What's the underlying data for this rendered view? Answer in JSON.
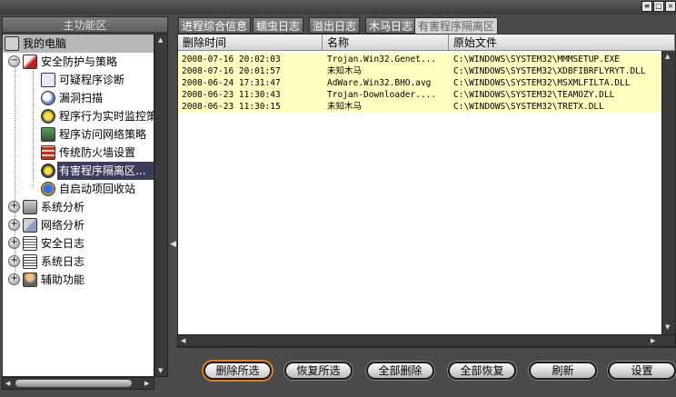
{
  "window": {
    "controls": [
      "≡",
      "□",
      "×"
    ]
  },
  "left_panel": {
    "title": "主功能区",
    "tree": [
      {
        "id": "my-computer",
        "label": "我的电脑"
      },
      {
        "id": "security-policy",
        "label": "安全防护与策略",
        "expander": "−"
      },
      {
        "id": "suspicious-diag",
        "label": "可疑程序诊断"
      },
      {
        "id": "vuln-scan",
        "label": "漏洞扫描"
      },
      {
        "id": "behavior-monitor",
        "label": "程序行为实时监控策"
      },
      {
        "id": "net-access",
        "label": "程序访问网络策略"
      },
      {
        "id": "firewall",
        "label": "传统防火墙设置"
      },
      {
        "id": "quarantine",
        "label": "有害程序隔离区"
      },
      {
        "id": "startup-recycle",
        "label": "自启动项回收站"
      },
      {
        "id": "sys-analysis",
        "label": "系统分析",
        "expander": "+"
      },
      {
        "id": "net-analysis",
        "label": "网络分析",
        "expander": "+"
      },
      {
        "id": "sec-log",
        "label": "安全日志",
        "expander": "+"
      },
      {
        "id": "sys-log",
        "label": "系统日志",
        "expander": "+"
      },
      {
        "id": "aux-func",
        "label": "辅助功能",
        "expander": "+"
      }
    ],
    "selected": "quarantine",
    "selected_suffix": "..."
  },
  "tabs": [
    {
      "label": "进程综合信息",
      "active": false
    },
    {
      "label": "蠕虫日志",
      "active": false
    },
    {
      "label": "溢出日志",
      "active": false
    },
    {
      "label": "木马日志",
      "active": false
    },
    {
      "label": "有害程序隔离区",
      "active": true
    }
  ],
  "table": {
    "columns": [
      "删除时间",
      "名称",
      "原始文件"
    ],
    "rows": [
      [
        "2008-07-16 20:02:03",
        "Trojan.Win32.Genet...",
        "C:\\WINDOWS\\SYSTEM32\\MMMSETUP.EXE"
      ],
      [
        "2008-07-16 20:01:57",
        "未知木马",
        "C:\\WINDOWS\\SYSTEM32\\XDBFIBRFLYRYT.DLL"
      ],
      [
        "2008-06-24 17:31:47",
        "AdWare.Win32.BHO.avg",
        "C:\\WINDOWS\\SYSTEM32\\MSXMLFILTA.DLL"
      ],
      [
        "2008-06-23 11:30:43",
        "Trojan-Downloader....",
        "C:\\WINDOWS\\SYSTEM32\\TEAMOZY.DLL"
      ],
      [
        "2008-06-23 11:30:15",
        "未知木马",
        "C:\\WINDOWS\\SYSTEM32\\TRETX.DLL"
      ]
    ]
  },
  "buttons": {
    "delete_selected": "删除所选",
    "restore_selected": "恢复所选",
    "delete_all": "全部删除",
    "restore_all": "全部恢复",
    "refresh": "刷新",
    "settings": "设置"
  },
  "colors": {
    "row_highlight": "#ffffc0",
    "selected_node": "#3c3c5c",
    "primary_button_ring": "#e08020"
  }
}
